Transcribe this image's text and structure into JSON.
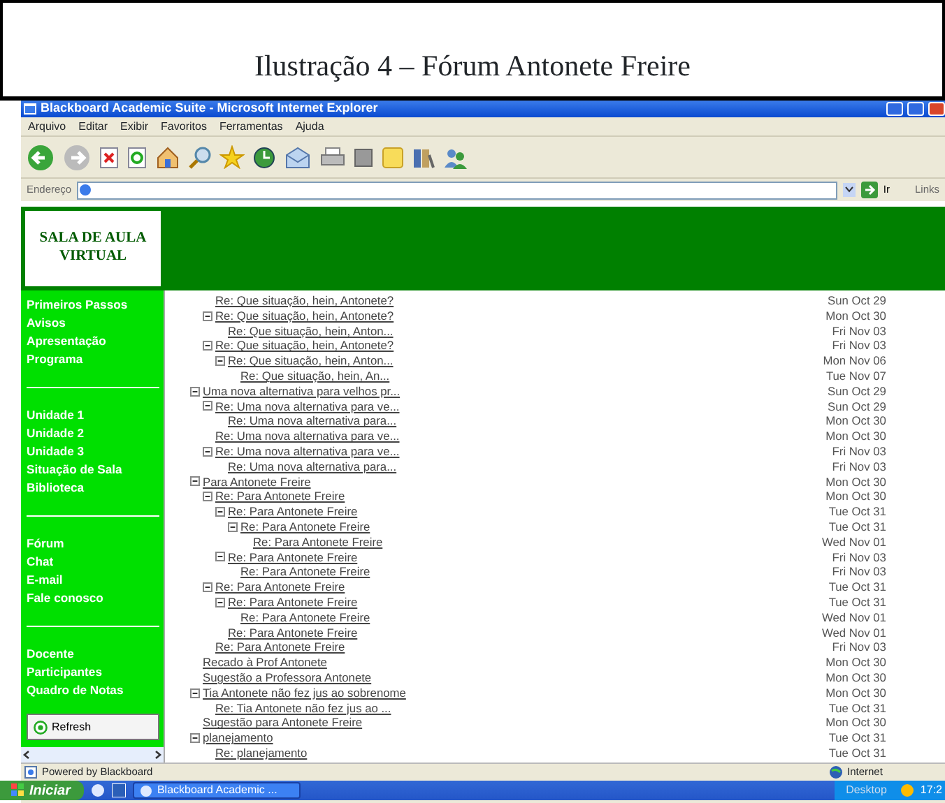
{
  "caption": "Ilustração 4 – Fórum Antonete Freire",
  "window": {
    "title": "Blackboard Academic Suite - Microsoft Internet Explorer"
  },
  "menu": [
    "Arquivo",
    "Editar",
    "Exibir",
    "Favoritos",
    "Ferramentas",
    "Ajuda"
  ],
  "address_bar": {
    "label": "Endereço",
    "go": "Ir",
    "links": "Links"
  },
  "logo": {
    "line_1": "SALA DE AULA",
    "line_2": "VIRTUAL"
  },
  "sidebar": {
    "groups": [
      [
        "Primeiros Passos",
        "Avisos",
        "Apresentação",
        "Programa"
      ],
      [
        "Unidade 1",
        "Unidade 2",
        "Unidade 3",
        "Situação de Sala",
        "Biblioteca"
      ],
      [
        "Fórum",
        "Chat",
        "E-mail",
        "Fale conosco"
      ],
      [
        "Docente",
        "Participantes",
        "Quadro de Notas"
      ]
    ],
    "refresh": "Refresh"
  },
  "forum_tree": [
    {
      "children": [
        {
          "subject": "Re: Que situação, hein, Antonete?",
          "date": "Sun Oct 29"
        },
        {
          "subject": "Re: Que situação, hein, Antonete?",
          "date": "Mon Oct 30",
          "expanded": true,
          "children": [
            {
              "subject": "Re: Que situação, hein, Anton...",
              "date": "Fri Nov 03"
            }
          ]
        },
        {
          "subject": "Re: Que situação, hein, Antonete?",
          "date": "Fri Nov 03",
          "expanded": true,
          "children": [
            {
              "subject": "Re: Que situação, hein, Anton...",
              "date": "Mon Nov 06",
              "expanded": true,
              "children": [
                {
                  "subject": "Re: Que situação, hein, An...",
                  "date": "Tue Nov 07"
                }
              ]
            }
          ]
        }
      ]
    },
    {
      "subject": "Uma nova alternativa para velhos pr...",
      "date": "Sun Oct 29",
      "expanded": true,
      "children": [
        {
          "subject": "Re: Uma nova alternativa para ve...",
          "date": "Sun Oct 29",
          "expanded": true,
          "children": [
            {
              "subject": "Re: Uma nova alternativa para...",
              "date": "Mon Oct 30"
            }
          ]
        },
        {
          "subject": "Re: Uma nova alternativa para ve...",
          "date": "Mon Oct 30"
        },
        {
          "subject": "Re: Uma nova alternativa para ve...",
          "date": "Fri Nov 03",
          "expanded": true,
          "children": [
            {
              "subject": "Re: Uma nova alternativa para...",
              "date": "Fri Nov 03"
            }
          ]
        }
      ]
    },
    {
      "subject": "Para Antonete Freire",
      "date": "Mon Oct 30",
      "expanded": true,
      "children": [
        {
          "subject": "Re: Para Antonete Freire",
          "date": "Mon Oct 30",
          "expanded": true,
          "children": [
            {
              "subject": "Re: Para Antonete Freire",
              "date": "Tue Oct 31",
              "expanded": true,
              "children": [
                {
                  "subject": "Re: Para Antonete Freire",
                  "date": "Tue Oct 31",
                  "expanded": true,
                  "children": [
                    {
                      "subject": "Re: Para Antonete Freire",
                      "date": "Wed Nov 01"
                    }
                  ]
                }
              ]
            },
            {
              "subject": "Re: Para Antonete Freire",
              "date": "Fri Nov 03",
              "expanded": true,
              "children": [
                {
                  "subject": "Re: Para Antonete Freire",
                  "date": "Fri Nov 03"
                }
              ]
            }
          ]
        },
        {
          "subject": "Re: Para Antonete Freire",
          "date": "Tue Oct 31",
          "expanded": true,
          "children": [
            {
              "subject": "Re: Para Antonete Freire",
              "date": "Tue Oct 31",
              "expanded": true,
              "children": [
                {
                  "subject": "Re: Para Antonete Freire",
                  "date": "Wed Nov 01"
                }
              ]
            },
            {
              "subject": "Re: Para Antonete Freire",
              "date": "Wed Nov 01"
            }
          ]
        },
        {
          "subject": "Re: Para Antonete Freire",
          "date": "Fri Nov 03"
        }
      ]
    },
    {
      "subject": "Recado à Prof Antonete",
      "date": "Mon Oct 30"
    },
    {
      "subject": "Sugestão a Professora Antonete",
      "date": "Mon Oct 30"
    },
    {
      "subject": "Tia Antonete não fez jus ao sobrenome",
      "date": "Mon Oct 30",
      "expanded": true,
      "children": [
        {
          "subject": "Re: Tia Antonete não fez jus ao ...",
          "date": "Tue Oct 31"
        }
      ]
    },
    {
      "subject": "Sugestão para Antonete Freire",
      "date": "Mon Oct 30"
    },
    {
      "subject": "planejamento",
      "date": "Tue Oct 31",
      "expanded": true,
      "children": [
        {
          "subject": "Re: planejamento",
          "date": "Tue Oct 31"
        }
      ]
    }
  ],
  "status_bar": {
    "left": "Powered by Blackboard",
    "zone": "Internet"
  },
  "taskbar": {
    "start": "Iniciar",
    "task": "Blackboard Academic ...",
    "desktop": "Desktop",
    "clock": "17:2"
  }
}
